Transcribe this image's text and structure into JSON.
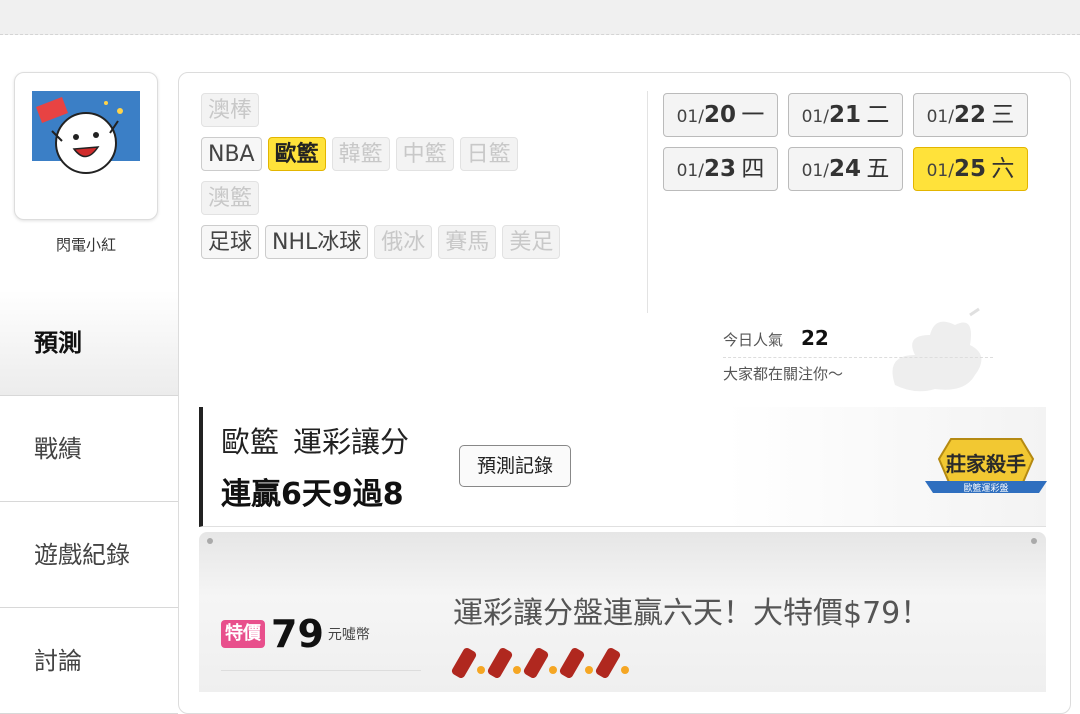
{
  "user": {
    "name": "閃電小紅"
  },
  "nav": {
    "items": [
      {
        "label": "預測"
      },
      {
        "label": "戰績"
      },
      {
        "label": "遊戲紀錄"
      },
      {
        "label": "討論"
      }
    ]
  },
  "tabs": {
    "rows": [
      [
        "澳棒"
      ],
      [
        "NBA",
        "歐籃",
        "韓籃",
        "中籃",
        "日籃"
      ],
      [
        "澳籃"
      ],
      [
        "足球",
        "NHL冰球",
        "俄冰",
        "賽馬",
        "美足"
      ]
    ],
    "active": "歐籃"
  },
  "dates": [
    {
      "md": "01/",
      "d": "20",
      "dow": "一"
    },
    {
      "md": "01/",
      "d": "21",
      "dow": "二"
    },
    {
      "md": "01/",
      "d": "22",
      "dow": "三"
    },
    {
      "md": "01/",
      "d": "23",
      "dow": "四"
    },
    {
      "md": "01/",
      "d": "24",
      "dow": "五"
    },
    {
      "md": "01/",
      "d": "25",
      "dow": "六"
    }
  ],
  "popularity": {
    "label": "今日人氣",
    "value": "22",
    "note": "大家都在關注你～"
  },
  "headline": {
    "league": "歐籃",
    "market": "運彩讓分",
    "streak": "連贏6天9過8",
    "record_button": "預測記錄",
    "badge_title": "莊家殺手",
    "badge_sub": "歐籃運彩盤"
  },
  "promo": {
    "tag": "特價",
    "price": "79",
    "unit": "元噓幣",
    "text": "運彩讓分盤連贏六天！大特價$79！"
  },
  "colors": {
    "accent": "#ffe23a",
    "tag": "#e84f8c"
  }
}
